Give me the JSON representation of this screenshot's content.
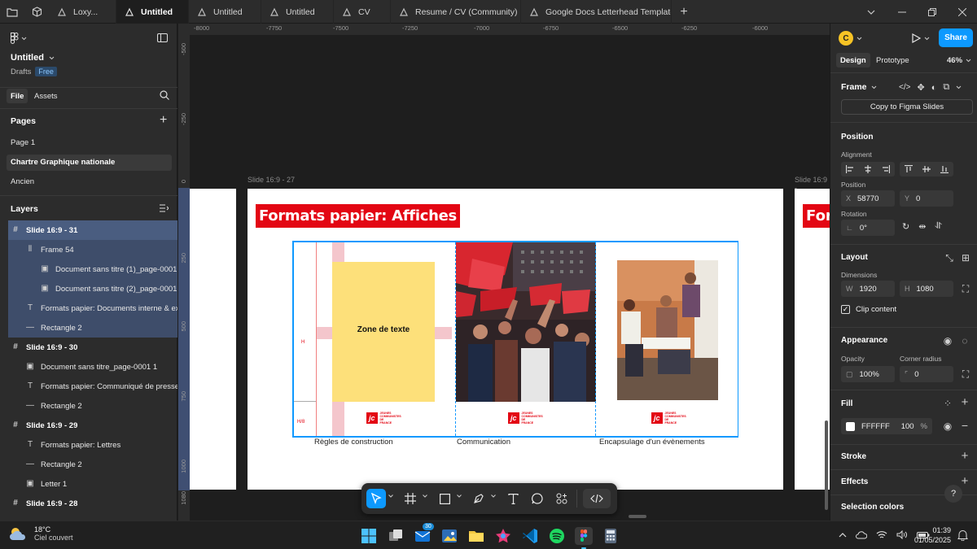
{
  "tabs": [
    {
      "label": "Loxy..."
    },
    {
      "label": "Untitled",
      "active": true
    },
    {
      "label": "Untitled"
    },
    {
      "label": "Untitled"
    },
    {
      "label": "CV"
    },
    {
      "label": "Resume / CV (Community)"
    },
    {
      "label": "Google Docs Letterhead Template (C"
    }
  ],
  "file": {
    "title": "Untitled",
    "location": "Drafts",
    "plan_badge": "Free"
  },
  "left_tabs": {
    "file": "File",
    "assets": "Assets"
  },
  "pages": {
    "heading": "Pages",
    "items": [
      "Page 1",
      "Chartre Graphique nationale",
      "Ancien"
    ]
  },
  "layers": {
    "heading": "Layers",
    "items": [
      {
        "label": "Slide 16:9 - 31",
        "icon": "frame-icon"
      },
      {
        "label": "Frame 54",
        "icon": "autolayout-icon"
      },
      {
        "label": "Document sans titre (1)_page-0001 1",
        "icon": "image-icon"
      },
      {
        "label": "Document sans titre (2)_page-0001 1",
        "icon": "image-icon"
      },
      {
        "label": "Formats papier: Documents interne & exter",
        "icon": "text-icon"
      },
      {
        "label": "Rectangle 2",
        "icon": "line-icon"
      },
      {
        "label": "Slide 16:9 - 30",
        "icon": "frame-icon"
      },
      {
        "label": "Document sans titre_page-0001 1",
        "icon": "image-icon"
      },
      {
        "label": "Formats papier: Communiqué de presse",
        "icon": "text-icon"
      },
      {
        "label": "Rectangle 2",
        "icon": "line-icon"
      },
      {
        "label": "Slide 16:9 - 29",
        "icon": "frame-icon"
      },
      {
        "label": "Formats papier: Lettres",
        "icon": "text-icon"
      },
      {
        "label": "Rectangle 2",
        "icon": "line-icon"
      },
      {
        "label": "Letter 1",
        "icon": "image-icon"
      },
      {
        "label": "Slide 16:9 - 28",
        "icon": "frame-icon"
      }
    ]
  },
  "ruler": {
    "top": [
      "-8000",
      "-7750",
      "-7500",
      "-7250",
      "-7000",
      "-6750",
      "-6500",
      "-6250",
      "-6000"
    ],
    "left": [
      "-500",
      "-250",
      "0",
      "250",
      "500",
      "750",
      "1000",
      "1080"
    ]
  },
  "canvas": {
    "slide_label_left": "Slide 16:9 - 27",
    "slide_label_right": "Slide 16:9 -",
    "slide_title": "Formats papier: Affiches",
    "right_slide_title": "For",
    "poster_zone_text": "Zone de texte",
    "captions": [
      "Règles de construction",
      "Communication",
      "Encapsulage d'un évènements"
    ],
    "guide_h": "H",
    "guide_h8": "H/8",
    "logo_initials": "jc",
    "logo_text": "JEUNES COMMUNISTES DE FRANCE"
  },
  "right": {
    "avatar_letter": "C",
    "share": "Share",
    "tab_design": "Design",
    "tab_prototype": "Prototype",
    "zoom": "46%",
    "frame_label": "Frame",
    "copy_slides": "Copy to Figma Slides",
    "position_heading": "Position",
    "alignment_label": "Alignment",
    "position_label": "Position",
    "x_key": "X",
    "x_val": "58770",
    "y_key": "Y",
    "y_val": "0",
    "rotation_label": "Rotation",
    "rotation_val": "0°",
    "layout_heading": "Layout",
    "dimensions_label": "Dimensions",
    "w_key": "W",
    "w_val": "1920",
    "h_key": "H",
    "h_val": "1080",
    "clip_content": "Clip content",
    "appearance_heading": "Appearance",
    "opacity_label": "Opacity",
    "opacity_val": "100%",
    "radius_label": "Corner radius",
    "radius_val": "0",
    "fill_heading": "Fill",
    "fill_hex": "FFFFFF",
    "fill_opacity": "100",
    "fill_pct": "%",
    "stroke_heading": "Stroke",
    "effects_heading": "Effects",
    "selection_colors": "Selection colors",
    "help": "?"
  },
  "taskbar": {
    "temp": "18°C",
    "weather": "Ciel couvert",
    "badge": "30",
    "time": "01:39",
    "date": "01/05/2025"
  },
  "colors": {
    "accent": "#0d99ff",
    "selection": "#4a5d80",
    "brand_red": "#e30613",
    "poster_yellow": "#fde07a",
    "poster_pink": "#f4c6cc"
  }
}
